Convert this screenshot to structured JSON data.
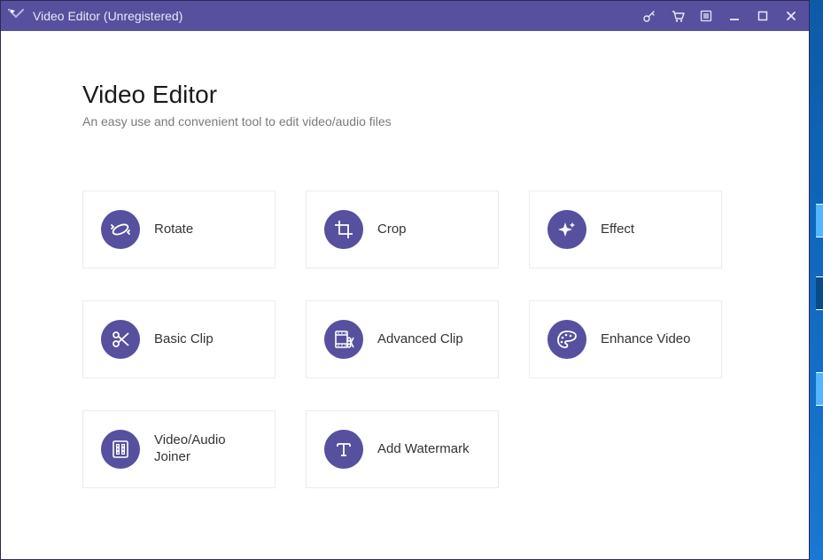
{
  "window": {
    "title": "Video Editor (Unregistered)"
  },
  "header": {
    "title": "Video Editor",
    "subtitle": "An easy use and convenient tool to edit video/audio files"
  },
  "tools": [
    {
      "id": "rotate",
      "label": "Rotate",
      "icon": "rotate-icon"
    },
    {
      "id": "crop",
      "label": "Crop",
      "icon": "crop-icon"
    },
    {
      "id": "effect",
      "label": "Effect",
      "icon": "sparkle-icon"
    },
    {
      "id": "basic-clip",
      "label": "Basic Clip",
      "icon": "scissors-icon"
    },
    {
      "id": "adv-clip",
      "label": "Advanced Clip",
      "icon": "film-scissors-icon"
    },
    {
      "id": "enhance",
      "label": "Enhance Video",
      "icon": "palette-icon"
    },
    {
      "id": "joiner",
      "label": "Video/Audio Joiner",
      "icon": "join-icon"
    },
    {
      "id": "watermark",
      "label": "Add Watermark",
      "icon": "text-icon"
    }
  ],
  "colors": {
    "accent": "#56509f"
  }
}
